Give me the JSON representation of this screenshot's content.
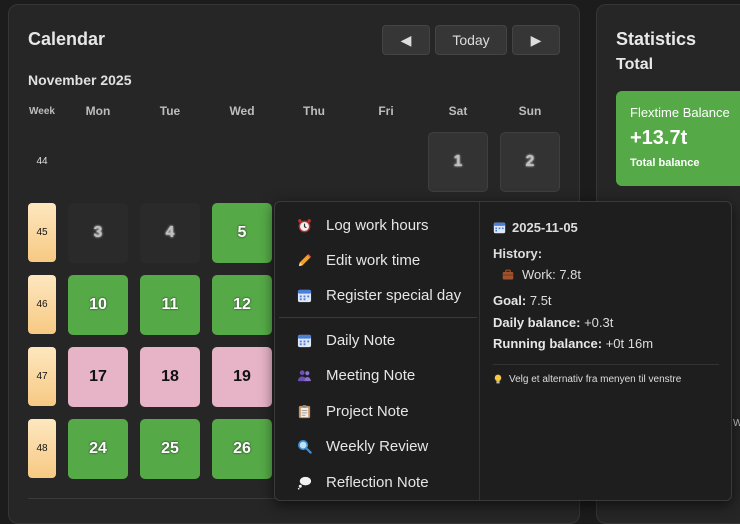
{
  "calendar": {
    "title": "Calendar",
    "nav": {
      "prev": "◀",
      "today": "Today",
      "next": "▶"
    },
    "month": "November 2025",
    "week_label": "Week",
    "days": [
      "Mon",
      "Tue",
      "Wed",
      "Thu",
      "Fri",
      "Sat",
      "Sun"
    ],
    "weeks": [
      "44",
      "45",
      "46",
      "47",
      "48"
    ],
    "cells": {
      "d1": "1",
      "d2": "2",
      "d3": "3",
      "d4": "4",
      "d5": "5",
      "d10": "10",
      "d11": "11",
      "d12": "12",
      "d17": "17",
      "d18": "18",
      "d19": "19",
      "d24": "24",
      "d25": "25",
      "d26": "26"
    }
  },
  "statistics": {
    "title": "Statistics",
    "subtitle": "Total",
    "card": {
      "label": "Flextime Balance",
      "value": "+13.7t",
      "sub": "Total balance"
    },
    "cut_text": "W"
  },
  "menu": {
    "items": [
      {
        "label": "Log work hours",
        "icon": "alarm-clock-icon"
      },
      {
        "label": "Edit work time",
        "icon": "pencil-icon"
      },
      {
        "label": "Register special day",
        "icon": "calendar-icon"
      },
      {
        "label": "Daily Note",
        "icon": "calendar-icon"
      },
      {
        "label": "Meeting Note",
        "icon": "people-icon"
      },
      {
        "label": "Project Note",
        "icon": "clipboard-icon"
      },
      {
        "label": "Weekly Review",
        "icon": "magnifier-icon"
      },
      {
        "label": "Reflection Note",
        "icon": "thought-bubble-icon"
      }
    ]
  },
  "details": {
    "date": "2025-11-05",
    "history_label": "History:",
    "work_entry": "Work: 7.8t",
    "goal_label": "Goal:",
    "goal_value": "7.5t",
    "daily_label": "Daily balance:",
    "daily_value": "+0.3t",
    "running_label": "Running balance:",
    "running_value": "+0t 16m",
    "hint": "Velg et alternativ fra menyen til venstre"
  },
  "colors": {
    "green": "#55aa47",
    "pink": "#e6b3c7",
    "week_highlight": "#f7c983"
  }
}
